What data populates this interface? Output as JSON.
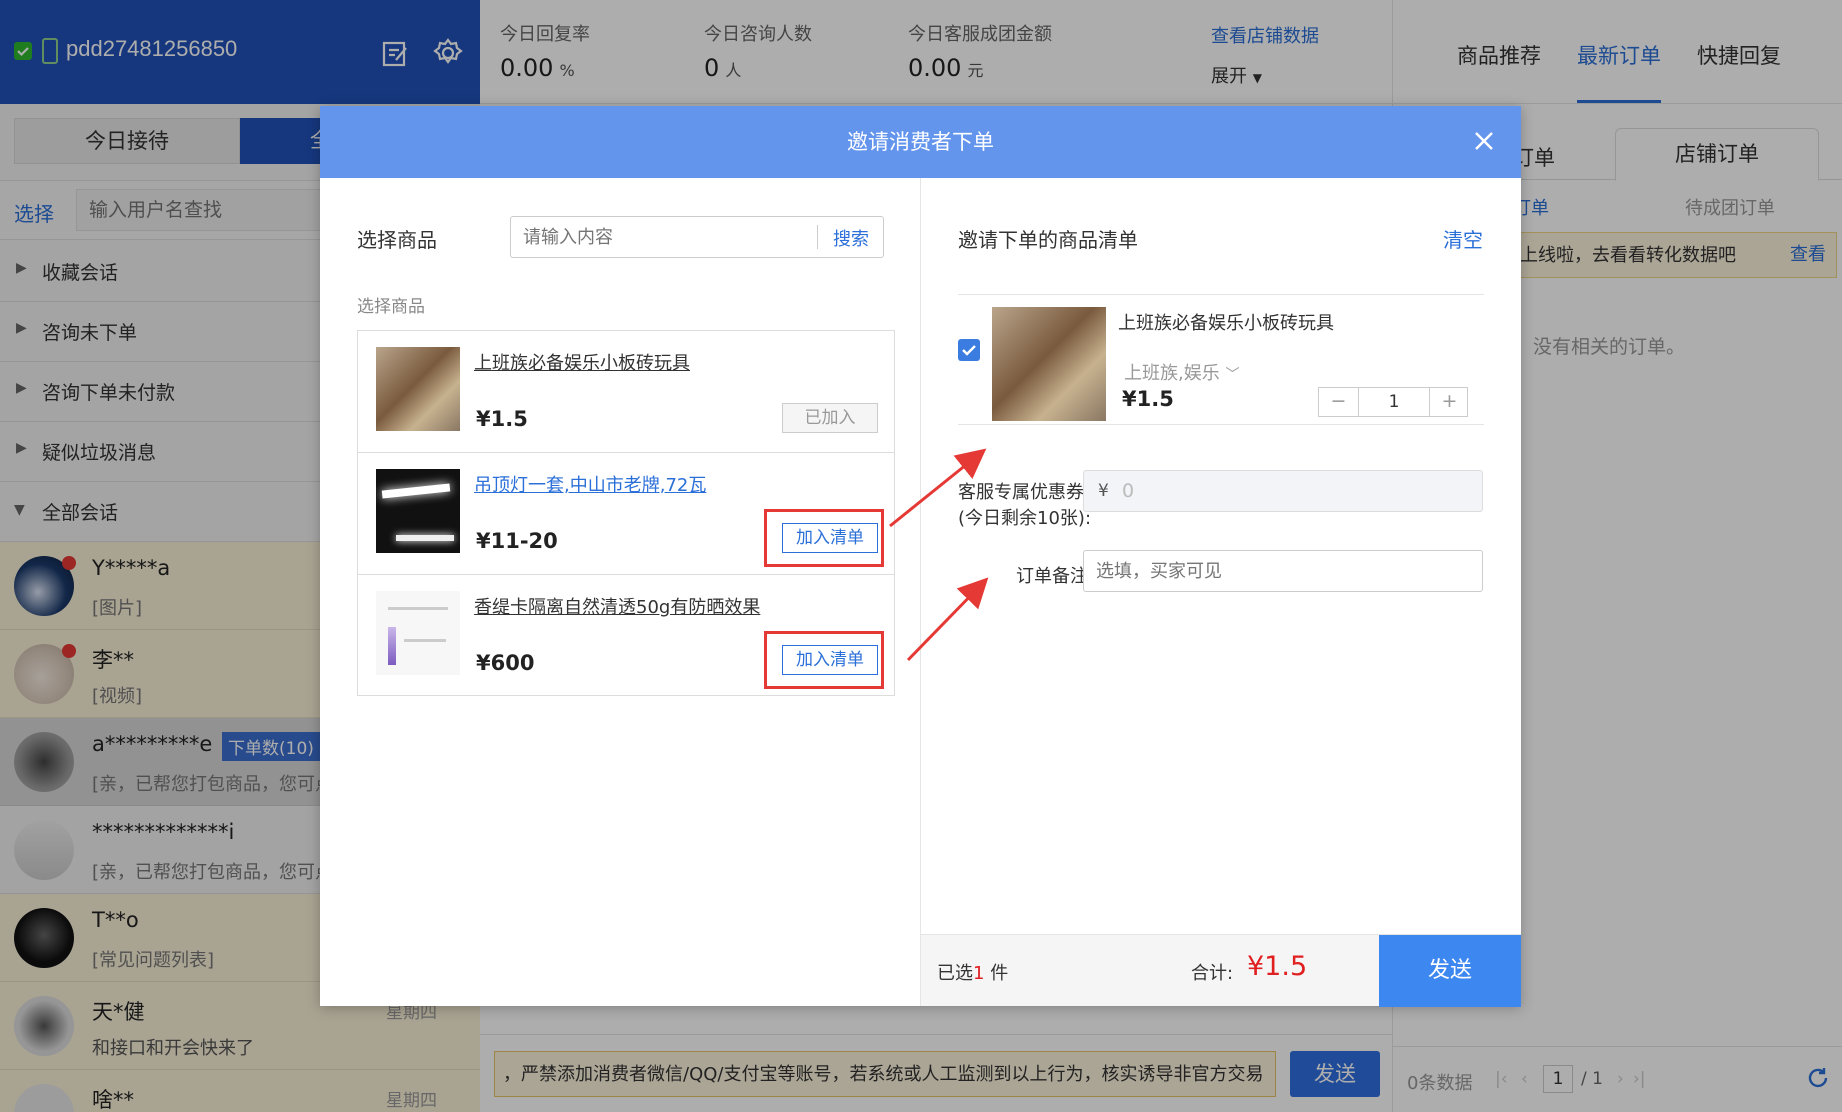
{
  "account": {
    "name": "pdd27481256850"
  },
  "stats": [
    {
      "label": "今日回复率",
      "value": "0.00",
      "unit": "%"
    },
    {
      "label": "今日咨询人数",
      "value": "0",
      "unit": "人"
    },
    {
      "label": "今日客服成团金额",
      "value": "0.00",
      "unit": "元"
    }
  ],
  "store_data_link": "查看店铺数据",
  "expand_label": "展开",
  "right_tabs": [
    "商品推荐",
    "最新订单",
    "快捷回复"
  ],
  "left_tabs": {
    "today": "今日接待",
    "partial": "全"
  },
  "search": {
    "select_label": "选择",
    "placeholder": "输入用户名查找"
  },
  "groups": [
    "收藏会话",
    "咨询未下单",
    "咨询下单未付款",
    "疑似垃圾消息",
    "全部会话"
  ],
  "conversations": [
    {
      "name": "Y*****a",
      "msg": "[图片]",
      "time": "",
      "badge": ""
    },
    {
      "name": "李**",
      "msg": "[视频]",
      "time": "",
      "badge": ""
    },
    {
      "name": "a*********e",
      "msg": "[亲，已帮您打包商品，您可点",
      "time": "",
      "badge": "下单数(10)"
    },
    {
      "name": "*************i",
      "msg": "[亲，已帮您打包商品，您可点",
      "time": "",
      "badge": ""
    },
    {
      "name": "T**o",
      "msg": "[常见问题列表]",
      "time": "",
      "badge": ""
    },
    {
      "name": "天*健",
      "msg": "和接口和开会快来了",
      "time": "星期四",
      "badge": ""
    },
    {
      "name": "啥**",
      "msg": "",
      "time": "星期四",
      "badge": ""
    }
  ],
  "order_panel": {
    "tab_partial": "订单",
    "tab_store": "店铺订单",
    "sub_partial": "订单",
    "sub_pending": "待成团订单",
    "notice": "据上线啦，去看看转化数据吧",
    "notice_link": "查看",
    "empty": "没有相关的订单。",
    "count": "0条数据",
    "page": "1",
    "total_pages": "/ 1"
  },
  "chat_input": {
    "warning": "，严禁添加消费者微信/QQ/支付宝等账号，若系统或人工监测到以上行为，核实诱导非官方交易",
    "send_label": "发送"
  },
  "modal": {
    "title": "邀请消费者下单",
    "select_product_label": "选择商品",
    "search_placeholder": "请输入内容",
    "search_btn": "搜索",
    "section_label": "选择商品",
    "products": [
      {
        "name": "上班族必备娱乐小板砖玩具",
        "price": "¥1.5",
        "action": "已加入"
      },
      {
        "name": "吊顶灯一套,中山市老牌,72瓦",
        "price": "¥11-20",
        "action": "加入清单"
      },
      {
        "name": "香缇卡隔离自然清透50g有防晒效果",
        "price": "¥600",
        "action": "加入清单"
      }
    ],
    "list_title": "邀请下单的商品清单",
    "clear_label": "清空",
    "item": {
      "name": "上班族必备娱乐小板砖玩具",
      "sku": "上班族,娱乐",
      "price": "¥1.5",
      "qty": "1"
    },
    "coupon_label": "客服专属优惠券",
    "coupon_remaining": "(今日剩余10张):",
    "coupon_prefix": "¥",
    "coupon_placeholder": "0",
    "remark_label": "订单备注:",
    "remark_placeholder": "选填，买家可见",
    "selected_prefix": "已选",
    "selected_count": "1",
    "selected_suffix": "件",
    "total_label": "合计:",
    "total_value": "¥1.5",
    "send_label": "发送"
  },
  "colors": {
    "header_blue": "#2152b8",
    "modal_header": "#6495ed",
    "accent": "#3a7ce0",
    "red": "#e02020",
    "send": "#3d87f0"
  }
}
